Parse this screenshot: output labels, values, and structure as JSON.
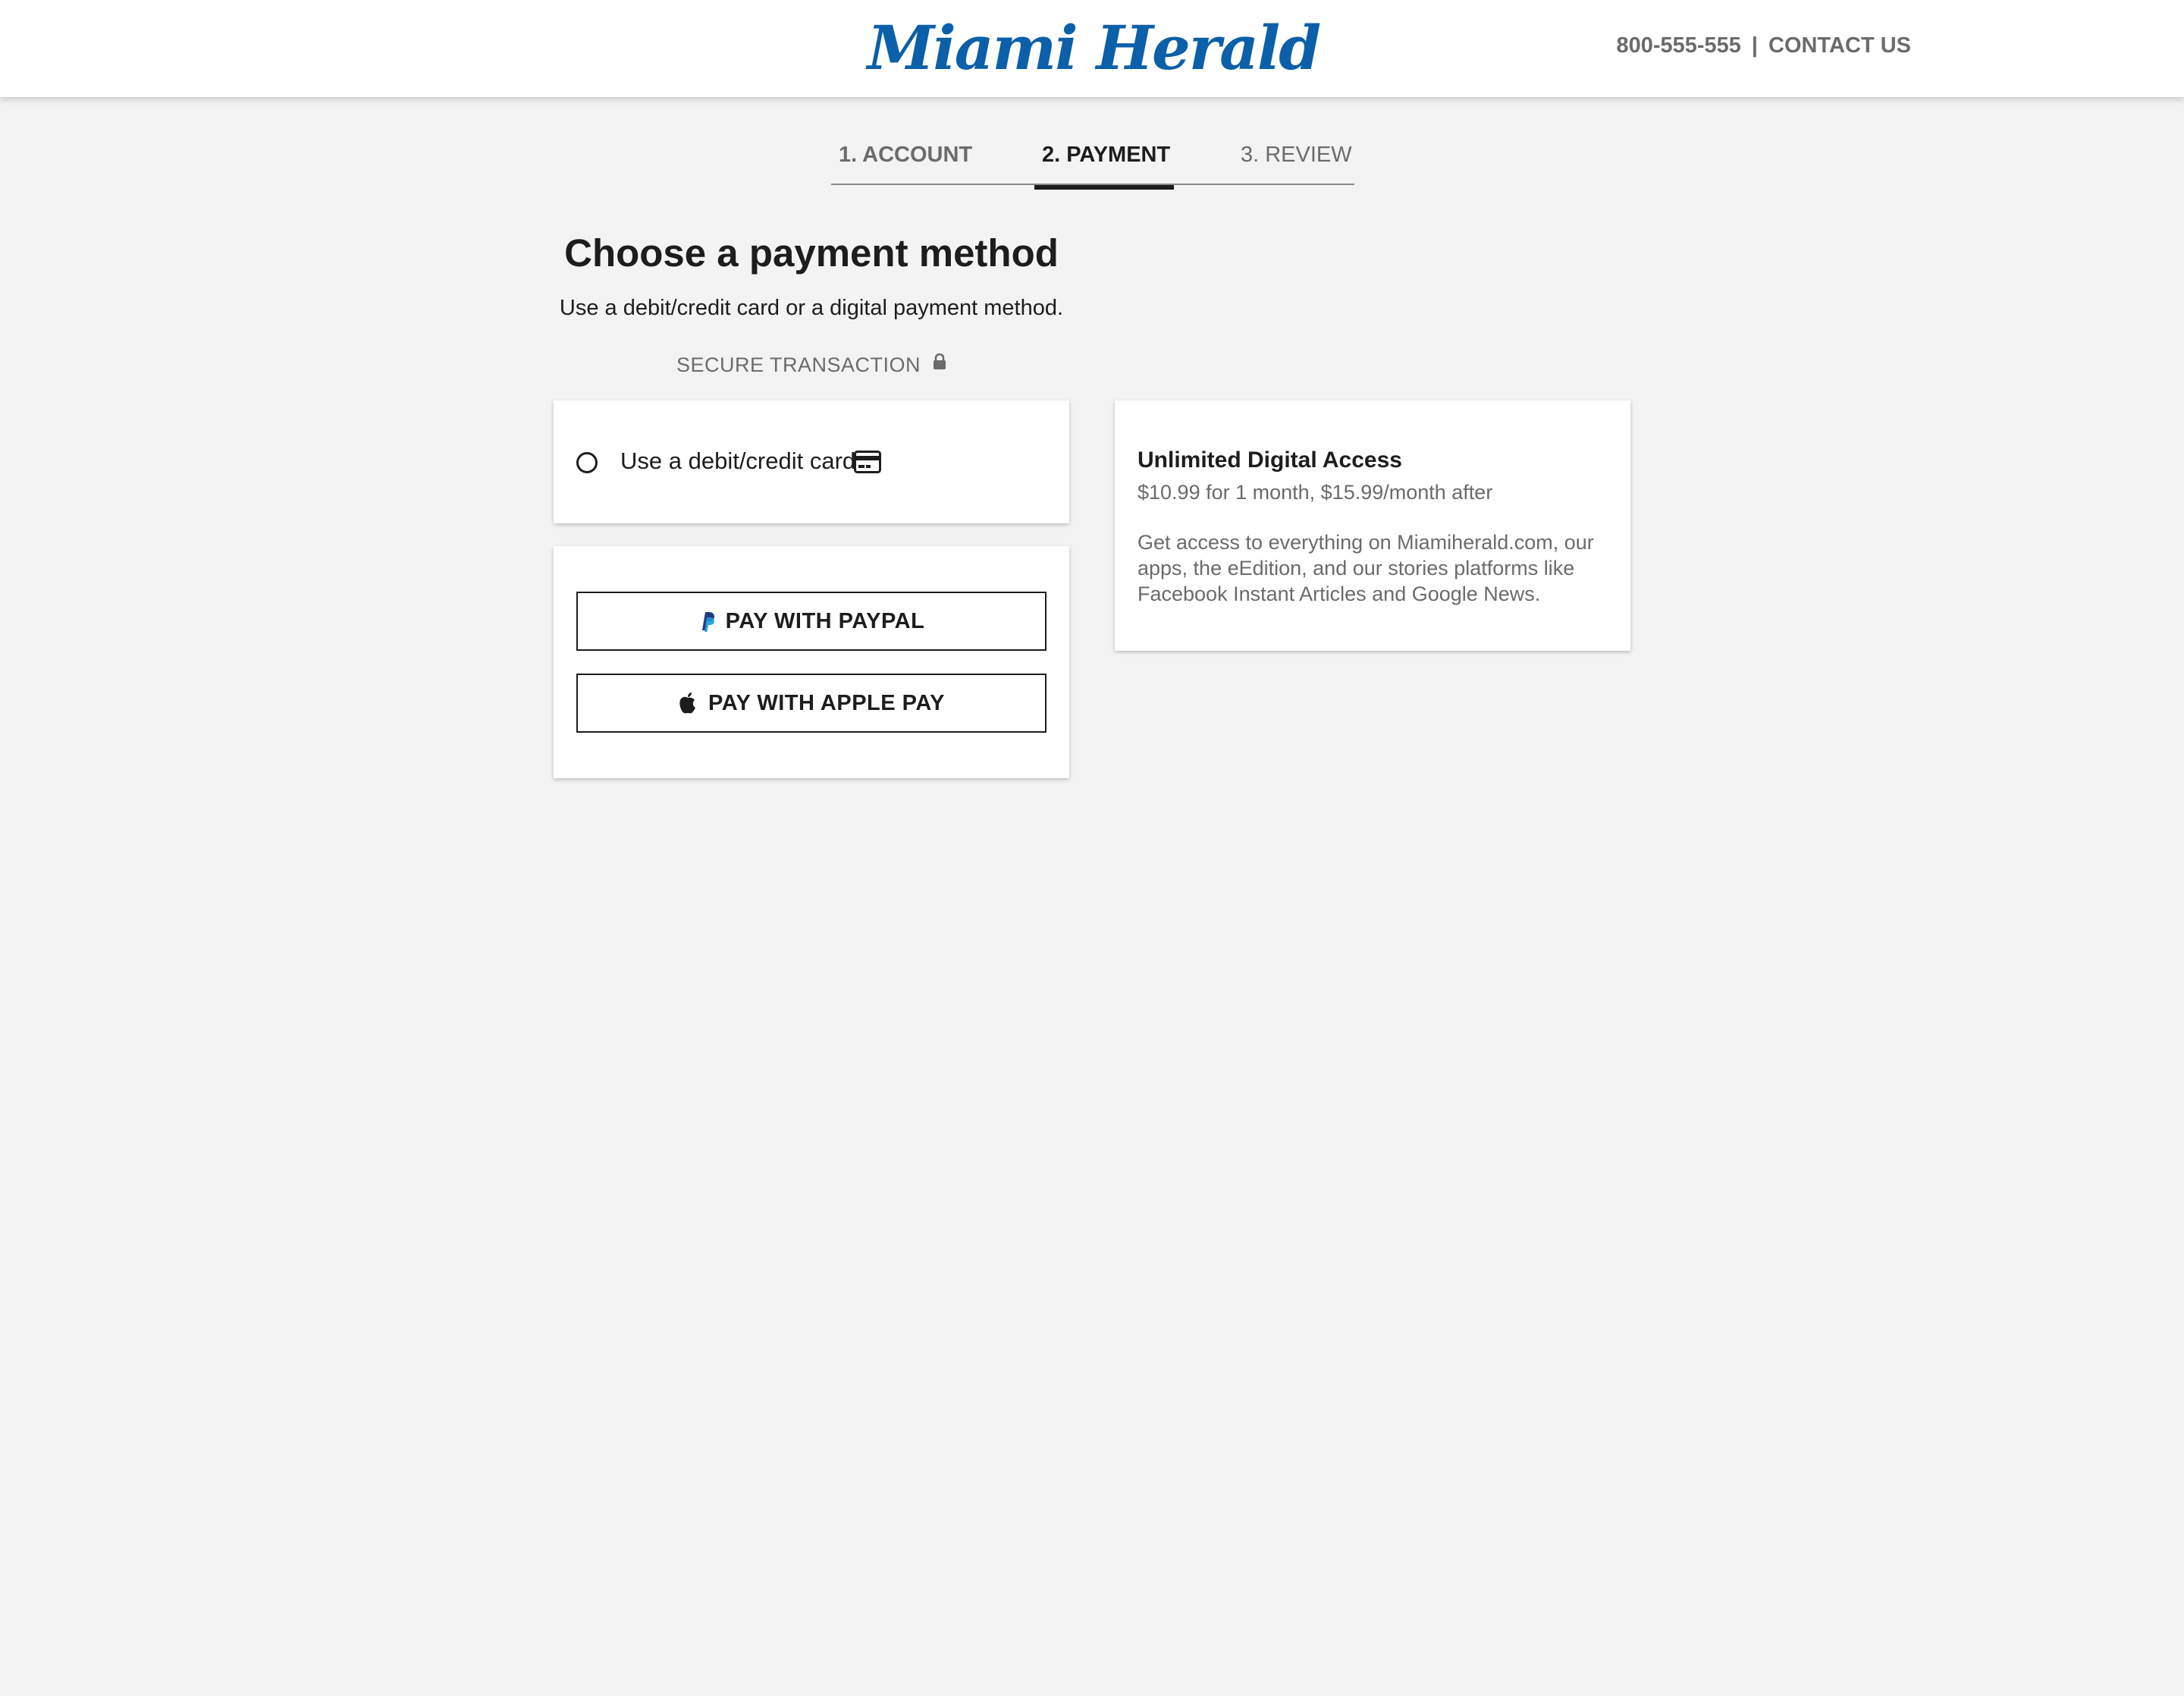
{
  "header": {
    "logo_text": "Miami Herald",
    "phone": "800-555-555",
    "separator": "|",
    "contact_label": "CONTACT US"
  },
  "steps": [
    {
      "label": "1. ACCOUNT",
      "state": "complete"
    },
    {
      "label": "2. PAYMENT",
      "state": "active"
    },
    {
      "label": "3. REVIEW",
      "state": "upcoming"
    }
  ],
  "main": {
    "title": "Choose a payment method",
    "subtitle": "Use a debit/credit card or a digital payment method.",
    "secure_label": "SECURE TRANSACTION",
    "secure_icon": "lock-icon"
  },
  "card_option": {
    "label": "Use a debit/credit card",
    "selected": false,
    "icon": "credit-card-icon"
  },
  "digital_payments": {
    "paypal_label": "PAY WITH PAYPAL",
    "paypal_icon": "paypal-icon",
    "applepay_label": "PAY WITH APPLE PAY",
    "applepay_icon": "apple-icon"
  },
  "offer": {
    "title": "Unlimited Digital Access",
    "price": "$10.99 for 1 month, $15.99/month after",
    "description": "Get access to everything on Miamiherald.com, our apps, the eEdition, and our stories platforms like Facebook Instant Articles and Google News."
  },
  "colors": {
    "brand": "#0c5fa9",
    "background": "#f3f3f3",
    "text": "#1d1d1d",
    "muted": "#6b6b6b",
    "paypal_blue": "#253b80"
  }
}
